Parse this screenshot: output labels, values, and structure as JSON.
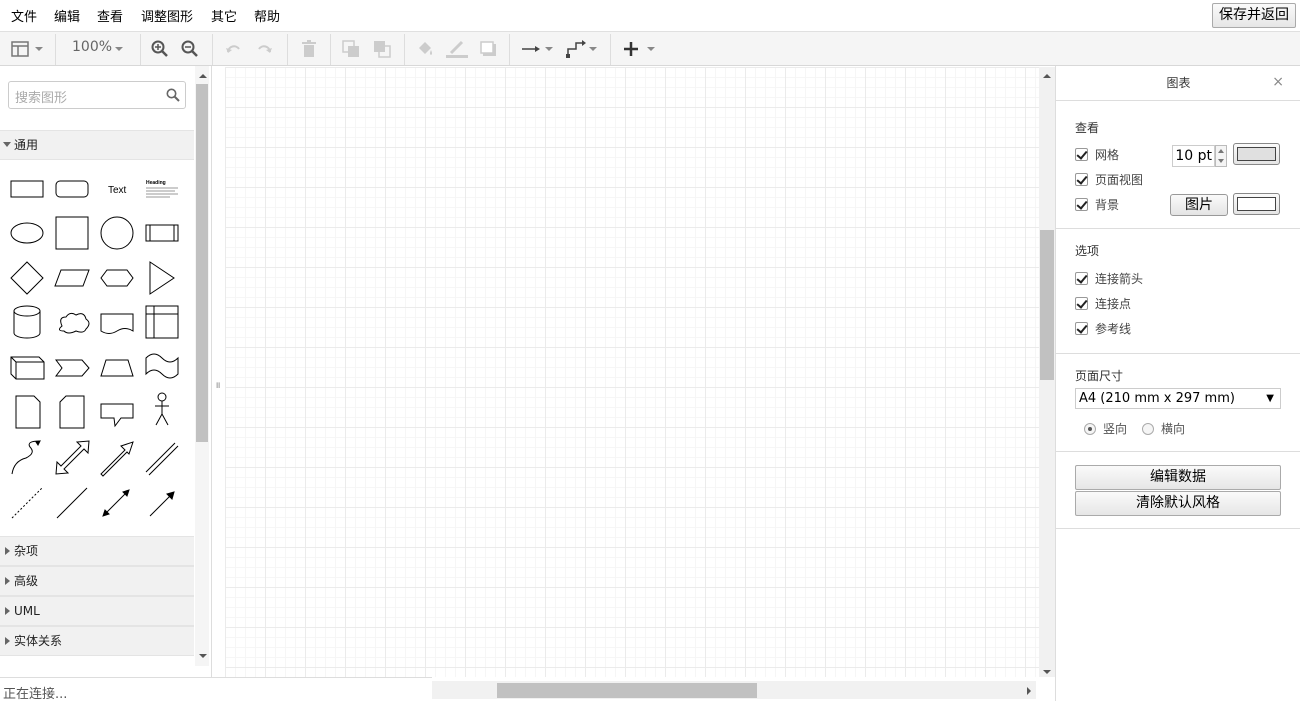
{
  "menubar": {
    "items": [
      "文件",
      "编辑",
      "查看",
      "调整图形",
      "其它",
      "帮助"
    ],
    "save_label": "保存并返回"
  },
  "toolbar": {
    "zoom": "100%",
    "icons": [
      "format-panel-icon",
      "zoom-in-icon",
      "zoom-out-icon",
      "undo-icon",
      "redo-icon",
      "delete-icon",
      "to-front-icon",
      "to-back-icon",
      "fill-color-icon",
      "line-color-icon",
      "shadow-icon",
      "connection-icon",
      "waypoints-icon",
      "insert-icon"
    ]
  },
  "sidebar": {
    "search_placeholder": "搜索图形",
    "sections": [
      "通用",
      "杂项",
      "高级",
      "UML",
      "实体关系"
    ],
    "text_shape": "Text",
    "heading_shape": "Heading"
  },
  "status": {
    "text": "正在连接..."
  },
  "format_panel": {
    "title": "图表",
    "close": "×",
    "view_section": "查看",
    "grid_label": "网格",
    "grid_size": "10 pt",
    "page_view_label": "页面视图",
    "background_label": "背景",
    "image_button": "图片",
    "options_section": "选项",
    "connection_arrows": "连接箭头",
    "connection_points": "连接点",
    "guides": "参考线",
    "page_size_section": "页面尺寸",
    "page_size_value": "A4 (210 mm x 297 mm)",
    "portrait": "竖向",
    "landscape": "横向",
    "edit_data_button": "编辑数据",
    "clear_style_button": "清除默认风格"
  }
}
